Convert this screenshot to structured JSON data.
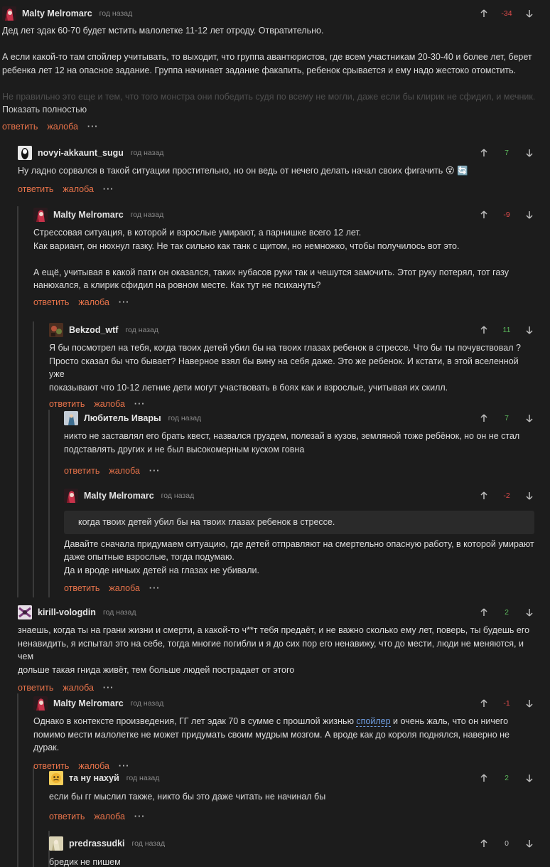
{
  "ui": {
    "reply": "ответить",
    "report": "жалоба",
    "more": "···",
    "show_full": "Показать полностью"
  },
  "colors": {
    "background": "#1c1c1c",
    "action_link": "#e8734a",
    "negative": "#e04b4b",
    "positive": "#5bb85b",
    "thread_line": "#3a3a3a",
    "spoiler": "#6f9de0"
  },
  "comments": [
    {
      "user": "Malty Melromarc",
      "time": "год назад",
      "score": "-34",
      "lines": [
        "Дед лет эдак 60-70 будет мстить малолетке 11-12 лет отроду. Отвратительно.",
        "",
        "А если какой-то там спойлер учитывать, то выходит, что группа авантюристов,  где всем участникам 20-30-40 и более лет, берет",
        "ребенка лет 12 на опасное задание. Группа начинает задание факапить, ребенок срывается и ему надо жестоко отомстить.",
        "",
        "Не правильно это еще и тем, что того монстра они победить судя по всему не могли, даже если бы клирик не сфидил, и мечник..."
      ]
    },
    {
      "user": "novyi-akkaunt_sugu",
      "time": "год назад",
      "score": "7",
      "lines": [
        "Ну ладно сорвался в такой ситуации простительно, но он ведь от нечего делать начал своих фигачить 😵 🔄"
      ]
    },
    {
      "user": "Malty Melromarc",
      "time": "год назад",
      "score": "-9",
      "lines": [
        "Стрессовая ситуация, в которой и взрослые умирают, а парнишке всего 12 лет.",
        "Как вариант, он нюхнул газку. Не так сильно как танк с щитом, но немножко, чтобы получилось вот это.",
        "",
        "А ещё, учитывая в какой пати он оказался, таких нубасов руки так и чешутся замочить. Этот руку потерял, тот  газу",
        "нанюхался, а клирик сфидил на ровном месте. Как тут не психануть?"
      ]
    },
    {
      "user": "Bekzod_wtf",
      "time": "год назад",
      "score": "11",
      "lines": [
        "Я бы посмотрел на тебя, когда твоих детей убил бы на твоих глазах ребенок в стрессе. Что бы ты почувствовал ?",
        "Просто сказал бы что бывает? Наверное взял бы вину на себя даже. Это же ребенок. И кстати, в этой вселенной уже",
        "показывают что 10-12 летние дети могут участвовать в боях как и взрослые, учитывая их скилл."
      ]
    },
    {
      "user": "Любитель Ивары",
      "time": "год назад",
      "score": "7",
      "lines": [
        "никто не заставлял его брать квест, назвался груздем, полезай в кузов, земляной тоже ребёнок, но он не стал",
        "подставлять других и не был высокомерным куском говна"
      ]
    },
    {
      "user": "Malty Melromarc",
      "time": "год назад",
      "score": "-2",
      "quote": "когда твоих детей убил бы на твоих глазах ребенок в стрессе.",
      "lines": [
        "Давайте сначала придумаем ситуацию, где детей отправляют на смертельно опасную работу, в которой умирают",
        "даже опытные взрослые, тогда подумаю.",
        "Да и вроде ничьих детей на глазах не убивали."
      ]
    },
    {
      "user": "kirill-vologdin",
      "time": "год назад",
      "score": "2",
      "lines": [
        "знаешь, когда ты на грани жизни и смерти, а какой-то ч**т тебя предаёт, и не важно сколько ему лет, поверь, ты будешь его",
        "ненавидить, я испытал это на себе, тогда многие погибли и я до сих пор его ненавижу, что до мести, люди не меняются, и чем",
        "дольше такая гнида живёт, тем больше людей пострадает от этого"
      ]
    },
    {
      "user": "Malty Melromarc",
      "time": "год назад",
      "score": "-1",
      "line1_before": "Однако в контексте произведения, ГГ лет эдак 70 в сумме с прошлой жизнью ",
      "spoiler": "спойлер",
      "line1_after": " и очень жаль, что он ничего",
      "lines": [
        "помимо мести малолетке не может придумать своим мудрым мозгом. А вроде как до короля поднялся, наверно не дурак."
      ]
    },
    {
      "user": "та ну нахуй",
      "time": "год назад",
      "score": "2",
      "lines": [
        "если бы гг мыслил также, никто бы это даже читать не начинал бы"
      ]
    },
    {
      "user": "predrassudki",
      "time": "год назад",
      "score": "0",
      "lines": [
        "бредик не пишем"
      ]
    }
  ]
}
